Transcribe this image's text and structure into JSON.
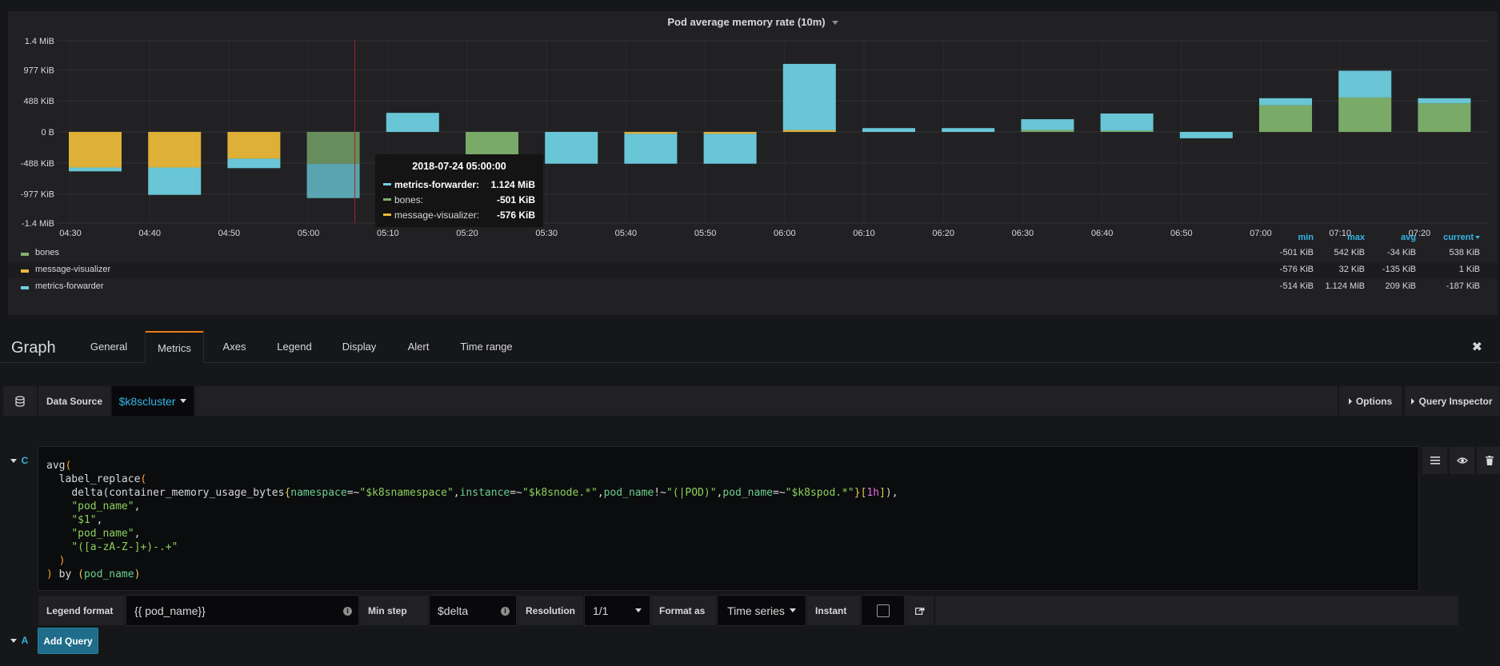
{
  "panel": {
    "title": "Pod average memory rate (10m)"
  },
  "chart_data": {
    "type": "bar",
    "stacked": true,
    "unit": "KiB",
    "x": [
      "04:30",
      "04:40",
      "04:50",
      "05:00",
      "05:10",
      "05:20",
      "05:30",
      "05:40",
      "05:50",
      "06:00",
      "06:10",
      "06:20",
      "06:30",
      "06:40",
      "06:50",
      "07:00",
      "07:10",
      "07:20"
    ],
    "x_ticks": [
      "04:30",
      "04:40",
      "04:50",
      "05:00",
      "05:10",
      "05:20",
      "05:30",
      "05:40",
      "05:50",
      "06:00",
      "06:10",
      "06:20",
      "06:30",
      "06:40",
      "06:50",
      "07:00",
      "07:10",
      "07:20"
    ],
    "y_ticks": [
      {
        "value": 1433.6,
        "label": "1.4 MiB"
      },
      {
        "value": 977,
        "label": "977 KiB"
      },
      {
        "value": 488,
        "label": "488 KiB"
      },
      {
        "value": 0,
        "label": "0 B"
      },
      {
        "value": -488,
        "label": "-488 KiB"
      },
      {
        "value": -977,
        "label": "-977 KiB"
      },
      {
        "value": -1433.6,
        "label": "-1.4 MiB"
      }
    ],
    "ylim": [
      -1433.6,
      1433.6
    ],
    "series": [
      {
        "name": "bones",
        "color": "#7eb26d",
        "values": [
          0,
          0,
          0,
          -501,
          0,
          -380,
          0,
          0,
          0,
          0,
          0,
          0,
          30,
          20,
          0,
          420,
          542,
          450
        ]
      },
      {
        "name": "message-visualizer",
        "color": "#eab839",
        "values": [
          -560,
          -560,
          -420,
          0,
          0,
          0,
          0,
          -30,
          -30,
          30,
          0,
          0,
          0,
          0,
          0,
          0,
          0,
          0
        ]
      },
      {
        "name": "metrics-forwarder",
        "color": "#6ed0e0",
        "values": [
          -60,
          -430,
          -150,
          -540,
          300,
          -30,
          -500,
          -470,
          -470,
          1040,
          60,
          60,
          170,
          270,
          -100,
          110,
          420,
          80
        ]
      }
    ],
    "hover_index": 3,
    "grid": true
  },
  "tooltip": {
    "time": "2018-07-24 05:00:00",
    "rows": [
      {
        "name": "metrics-forwarder:",
        "value": "1.124 MiB",
        "color": "#6ed0e0",
        "highlight": true
      },
      {
        "name": "bones:",
        "value": "-501 KiB",
        "color": "#7eb26d",
        "highlight": false
      },
      {
        "name": "message-visualizer:",
        "value": "-576 KiB",
        "color": "#eab839",
        "highlight": false
      }
    ]
  },
  "legend": {
    "headers": {
      "min": "min",
      "max": "max",
      "avg": "avg",
      "current": "current"
    },
    "rows": [
      {
        "name": "bones",
        "color": "#7eb26d",
        "min": "-501 KiB",
        "max": "542 KiB",
        "avg": "-34 KiB",
        "current": "538 KiB"
      },
      {
        "name": "message-visualizer",
        "color": "#eab839",
        "min": "-576 KiB",
        "max": "32 KiB",
        "avg": "-135 KiB",
        "current": "1 KiB"
      },
      {
        "name": "metrics-forwarder",
        "color": "#6ed0e0",
        "min": "-514 KiB",
        "max": "1.124 MiB",
        "avg": "209 KiB",
        "current": "-187 KiB"
      }
    ]
  },
  "editor": {
    "title": "Graph",
    "tabs": [
      "General",
      "Metrics",
      "Axes",
      "Legend",
      "Display",
      "Alert",
      "Time range"
    ],
    "active_tab": "Metrics"
  },
  "datasource": {
    "label": "Data Source",
    "value": "$k8scluster",
    "options_label": "Options",
    "inspector_label": "Query Inspector"
  },
  "query": {
    "ref_id": "C",
    "options": {
      "legend_label": "Legend format",
      "legend_value": "{{ pod_name}}",
      "minstep_label": "Min step",
      "minstep_value": "$delta",
      "resolution_label": "Resolution",
      "resolution_value": "1/1",
      "format_label": "Format as",
      "format_value": "Time series",
      "instant_label": "Instant"
    }
  },
  "add": {
    "ref_id": "A",
    "label": "Add Query"
  }
}
